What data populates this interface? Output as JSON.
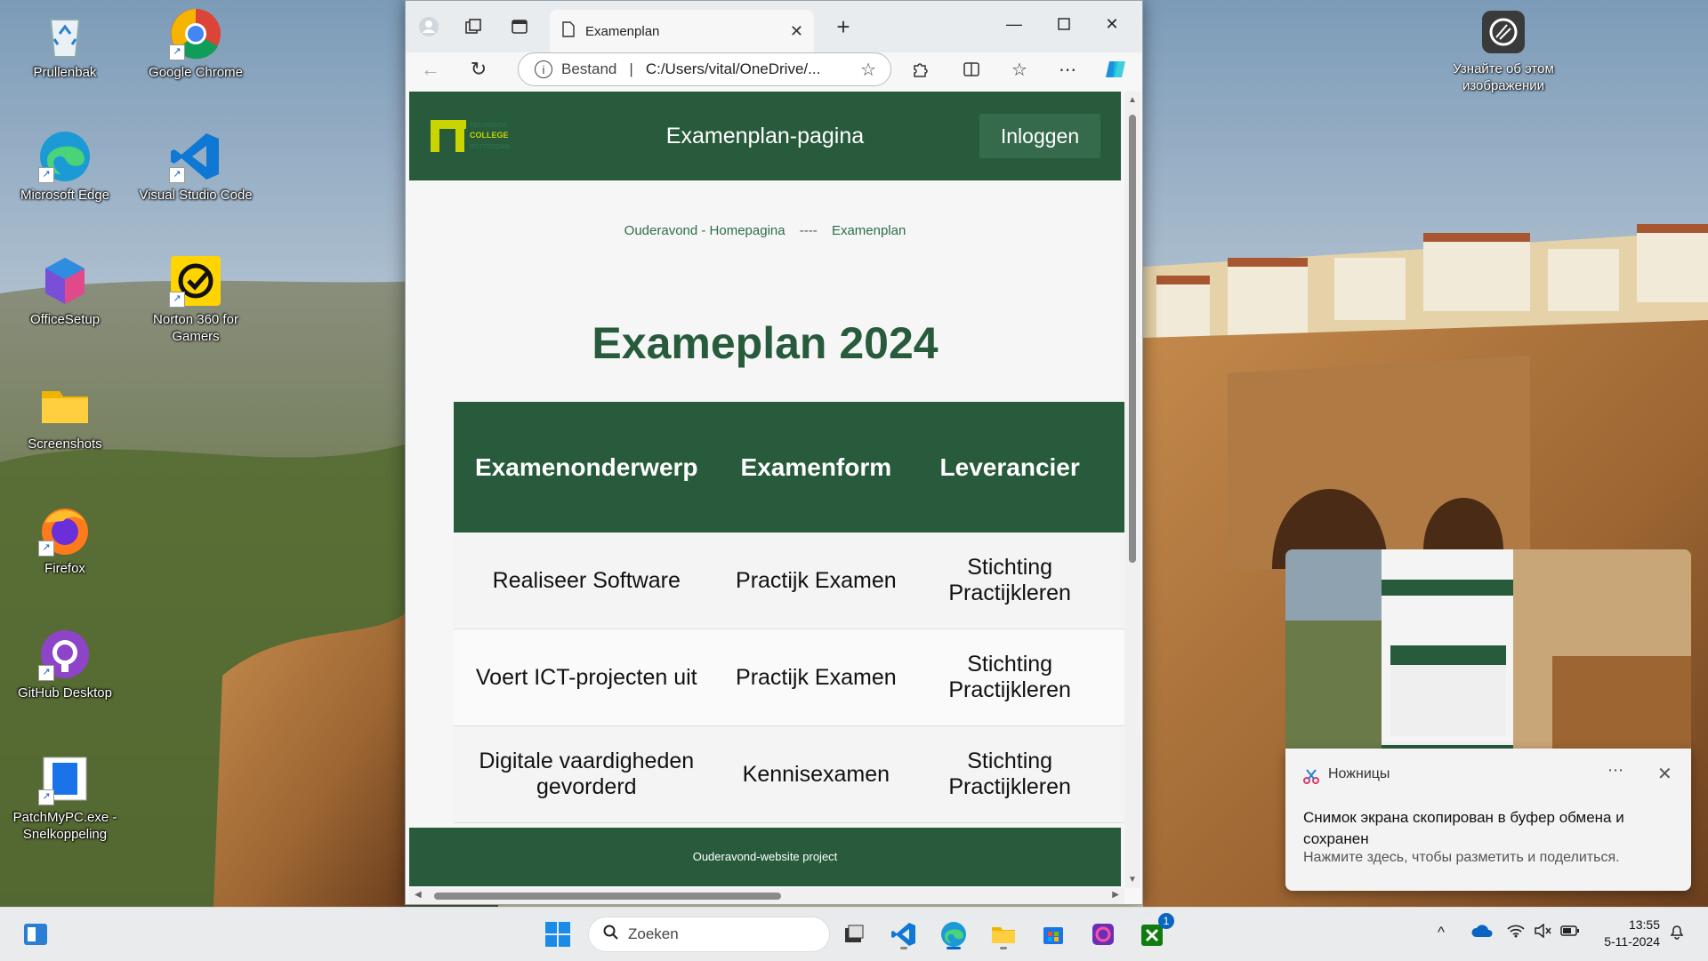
{
  "desktop": {
    "icons": [
      {
        "label": "Prullenbak"
      },
      {
        "label": "Google Chrome"
      },
      {
        "label": "Microsoft Edge"
      },
      {
        "label": "Visual Studio Code"
      },
      {
        "label": "OfficeSetup"
      },
      {
        "label": "Norton 360 for Gamers"
      },
      {
        "label": "Screenshots"
      },
      {
        "label": "Firefox"
      },
      {
        "label": "GitHub Desktop"
      },
      {
        "label": "PatchMyPC.exe - Snelkoppeling"
      }
    ],
    "wallpaper_info_label": "Узнайте об этом изображении"
  },
  "browser": {
    "tab_title": "Examenplan",
    "address": {
      "security_label": "Bestand",
      "url": "C:/Users/vital/OneDrive/..."
    }
  },
  "page": {
    "logo_text": [
      "TECHNISCH",
      "COLLEGE",
      "ROTTERDAM"
    ],
    "header_title": "Examenplan-pagina",
    "login_label": "Inloggen",
    "breadcrumb": {
      "home": "Ouderavond - Homepagina",
      "separator": "----",
      "current": "Examenplan"
    },
    "heading": "Exameplan 2024",
    "table": {
      "headers": [
        "Examenonderwerp",
        "Examenform",
        "Leverancier"
      ],
      "rows": [
        [
          "Realiseer Software",
          "Practijk Examen",
          "Stichting Practijkleren"
        ],
        [
          "Voert ICT-projecten uit",
          "Practijk Examen",
          "Stichting Practijkleren"
        ],
        [
          "Digitale vaardigheden gevorderd",
          "Kennisexamen",
          "Stichting Practijkleren"
        ]
      ]
    },
    "footer": "Ouderavond-website project"
  },
  "notification": {
    "app": "Ножницы",
    "message": "Снимок экрана скопирован в буфер обмена и сохранен",
    "action": "Нажмите здесь, чтобы разметить и поделиться."
  },
  "taskbar": {
    "search_placeholder": "Zoeken",
    "time": "13:55",
    "date": "5-11-2024",
    "xbox_badge": "1"
  },
  "colors": {
    "site_green": "#275b3c",
    "link_green": "#2c6e48",
    "accent_blue": "#0a64c2"
  }
}
